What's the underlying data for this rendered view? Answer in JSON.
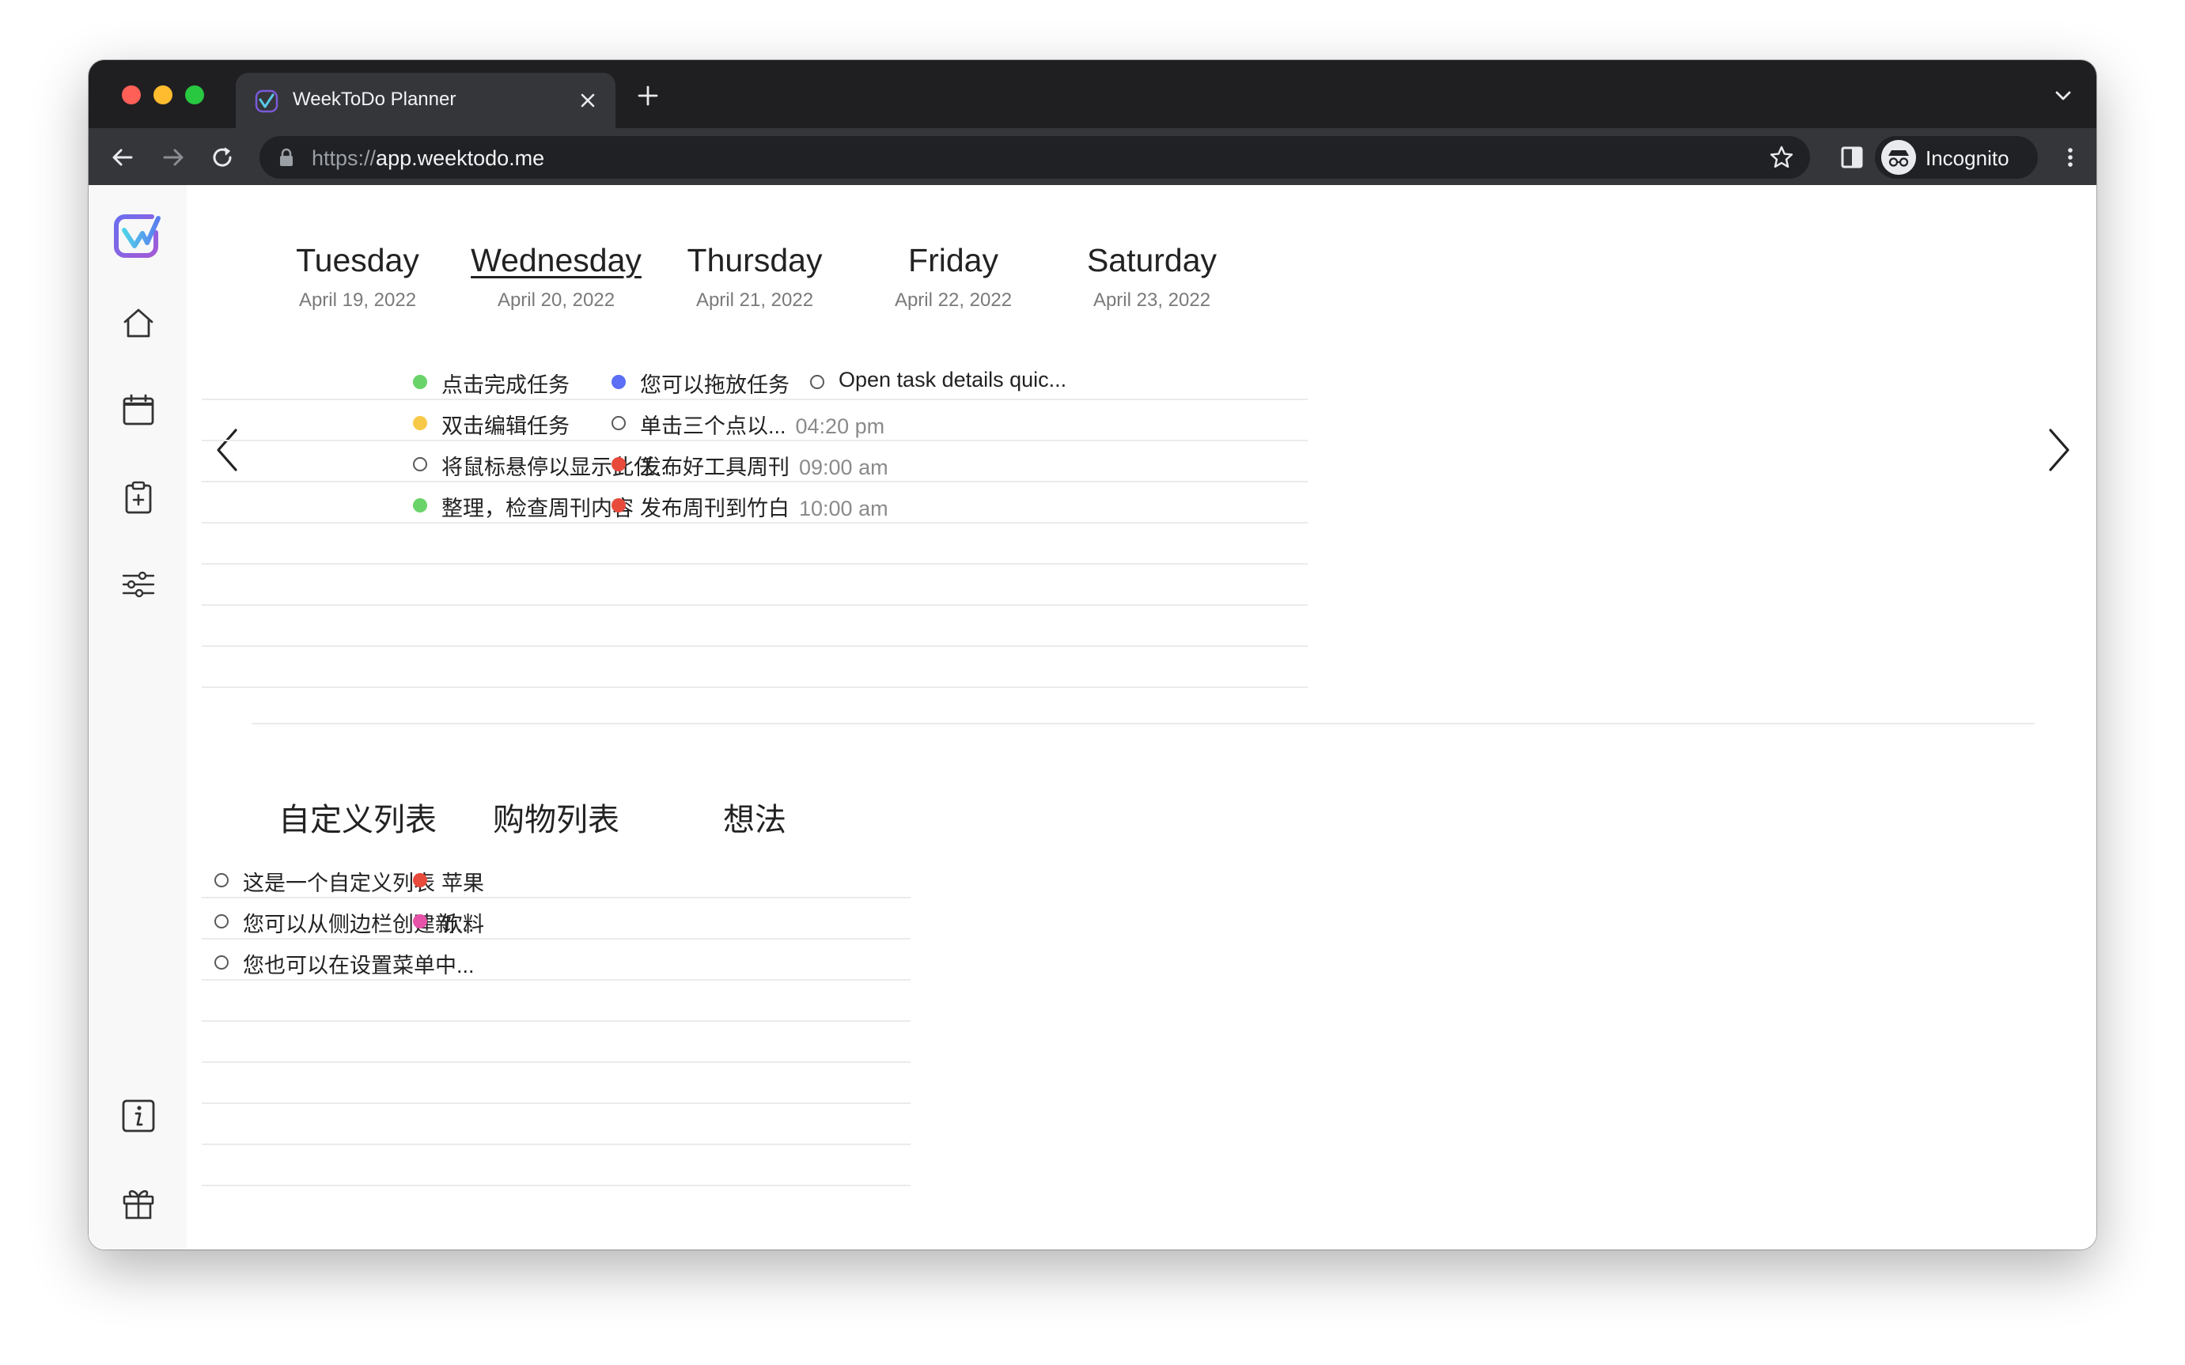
{
  "browser": {
    "tab_title": "WeekToDo Planner",
    "url_scheme": "https://",
    "url_host": "app.weektodo.me",
    "profile_label": "Incognito"
  },
  "colors": {
    "green": "#6ad46a",
    "yellow": "#f7c948",
    "blue": "#5b6ef5",
    "red": "#e84a3c",
    "pink": "#e752a9"
  },
  "sidebar": {
    "items": [
      {
        "name": "logo",
        "icon": "weektodo-logo"
      },
      {
        "name": "home",
        "icon": "home-icon"
      },
      {
        "name": "calendar",
        "icon": "calendar-icon"
      },
      {
        "name": "custom-lists",
        "icon": "clipboard-plus-icon"
      },
      {
        "name": "settings",
        "icon": "sliders-icon"
      },
      {
        "name": "about",
        "icon": "info-icon"
      },
      {
        "name": "donate",
        "icon": "gift-icon"
      }
    ]
  },
  "days": [
    {
      "name": "Tuesday",
      "date": "April 19, 2022",
      "current": false,
      "tasks": []
    },
    {
      "name": "Wednesday",
      "date": "April 20, 2022",
      "current": true,
      "tasks": [
        {
          "text": "点击完成任务",
          "color": "green",
          "time": ""
        },
        {
          "text": "双击编辑任务",
          "color": "yellow",
          "time": ""
        },
        {
          "text": "将鼠标悬停以显示此任...",
          "color": "none",
          "time": ""
        },
        {
          "text": "整理，检查周刊内容",
          "color": "green",
          "time": ""
        }
      ]
    },
    {
      "name": "Thursday",
      "date": "April 21, 2022",
      "current": false,
      "tasks": [
        {
          "text": "您可以拖放任务",
          "color": "blue",
          "time": ""
        },
        {
          "text": "单击三个点以...",
          "color": "none",
          "time": "04:20 pm"
        },
        {
          "text": "发布好工具周刊",
          "color": "red",
          "time": "09:00 am"
        },
        {
          "text": "发布周刊到竹白",
          "color": "red",
          "time": "10:00 am"
        }
      ]
    },
    {
      "name": "Friday",
      "date": "April 22, 2022",
      "current": false,
      "tasks": [
        {
          "text": "Open task details quic...",
          "color": "none",
          "time": ""
        }
      ]
    },
    {
      "name": "Saturday",
      "date": "April 23, 2022",
      "current": false,
      "tasks": []
    }
  ],
  "lists": [
    {
      "title": "自定义列表",
      "tasks": [
        {
          "text": "这是一个自定义列表",
          "color": "none"
        },
        {
          "text": "您可以从侧边栏创建新...",
          "color": "none"
        },
        {
          "text": "您也可以在设置菜单中...",
          "color": "none"
        }
      ]
    },
    {
      "title": "购物列表",
      "tasks": [
        {
          "text": "苹果",
          "color": "red"
        },
        {
          "text": "饮料",
          "color": "pink"
        }
      ]
    },
    {
      "title": "想法",
      "tasks": []
    }
  ]
}
